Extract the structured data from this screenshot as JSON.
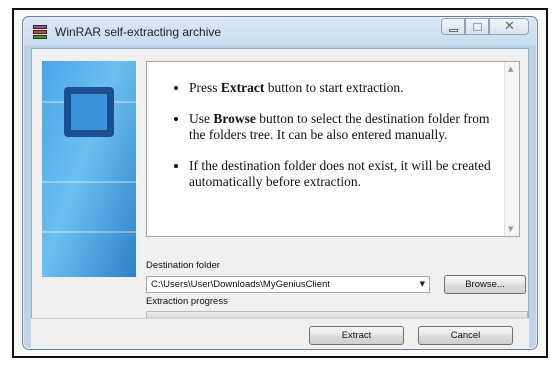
{
  "window": {
    "title": "WinRAR self-extracting archive",
    "icon": "winrar-icon",
    "controls": {
      "minimize": "minimize-icon",
      "maximize": "maximize-icon",
      "close": "✕"
    }
  },
  "instructions": {
    "items": [
      {
        "pre": "Press ",
        "bold": "Extract",
        "post": " button to start extraction."
      },
      {
        "pre": "Use ",
        "bold": "Browse",
        "post": " button to select the destination folder from the folders tree. It can be also entered manually."
      },
      {
        "pre": "If the destination folder does not exist, it will be created automatically before extraction.",
        "bold": "",
        "post": ""
      }
    ]
  },
  "destination": {
    "label": "Destination folder",
    "value": "C:\\Users\\User\\Downloads\\MyGeniusClient",
    "dropdown_arrow": "▼",
    "browse_label": "Browse..."
  },
  "progress": {
    "label": "Extraction progress",
    "value": 0
  },
  "buttons": {
    "extract": "Extract",
    "cancel": "Cancel"
  },
  "colors": {
    "progress_fill": "#3cb23c",
    "side_panel": "#49a6e6"
  }
}
